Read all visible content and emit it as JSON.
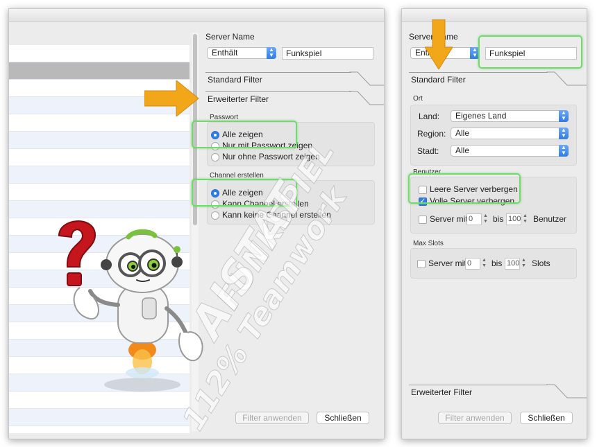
{
  "left": {
    "server_name_label": "Server Name",
    "match_select": "Enthält",
    "server_name_value": "Funkspiel",
    "standard_filter_tab": "Standard Filter",
    "extended_filter_tab": "Erweiterter Filter",
    "password_section": "Passwort",
    "password_options": [
      "Alle zeigen",
      "Nur mit Passwort zeigen",
      "Nur ohne Passwort zeigen"
    ],
    "channel_section": "Channel erstellen",
    "channel_options": [
      "Alle zeigen",
      "Kann Channel erstellen",
      "Kann keine Channel erstellen"
    ],
    "apply_button": "Filter anwenden",
    "close_button": "Schließen"
  },
  "right": {
    "server_name_label": "Server Name",
    "match_select": "Enthält",
    "server_name_value": "Funkspiel",
    "standard_filter_tab": "Standard Filter",
    "location_section": "Ort",
    "land_label": "Land:",
    "land_value": "Eigenes Land",
    "region_label": "Region:",
    "region_value": "Alle",
    "city_label": "Stadt:",
    "city_value": "Alle",
    "users_section": "Benutzer",
    "hide_empty": "Leere Server verbergen",
    "hide_full": "Volle Server verbergen",
    "server_with": "Server mit",
    "to": "bis",
    "users_min": "0",
    "users_max": "100",
    "users_unit": "Benutzer",
    "max_slots_section": "Max Slots",
    "slots_min": "0",
    "slots_max": "100",
    "slots_unit": "Slots",
    "extended_filter_tab": "Erweiterter Filter",
    "apply_button": "Filter anwenden",
    "close_button": "Schließen"
  },
  "watermark": {
    "line1": "FUNKSPIEL",
    "line2": "AISTAT",
    "line3": "112% Teamwork"
  },
  "colors": {
    "highlight": "#6fdc6a",
    "arrow": "#f2a71b",
    "accent": "#2f7de6"
  }
}
